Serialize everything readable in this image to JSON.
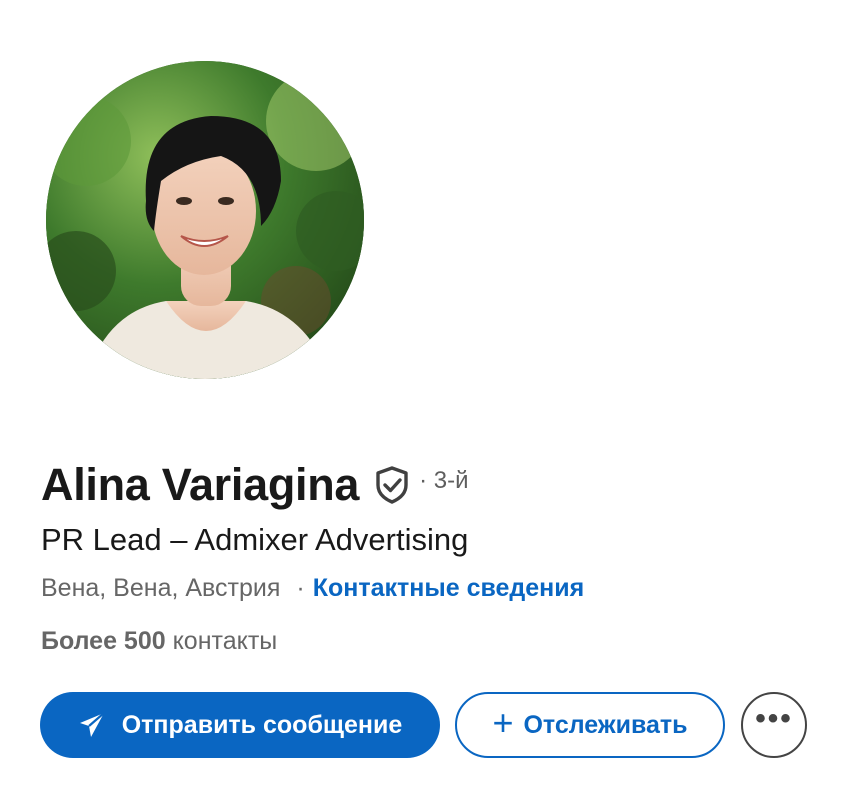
{
  "profile": {
    "name": "Alina Variagina",
    "degree": "· 3-й",
    "headline": "PR Lead – Admixer Advertising",
    "location": "Вена, Вена, Австрия",
    "separator": "·",
    "contact_info_label": "Контактные сведения",
    "connections_count": "Более 500",
    "connections_suffix": "контакты"
  },
  "actions": {
    "message_label": "Отправить сообщение",
    "message_icon": "send-icon",
    "follow_label": "Отслеживать",
    "follow_icon": "plus-icon",
    "more_icon": "more-icon",
    "more_glyph": "•••"
  },
  "colors": {
    "accent": "#0a66c2",
    "text_primary": "#191919",
    "text_secondary": "#666666"
  }
}
